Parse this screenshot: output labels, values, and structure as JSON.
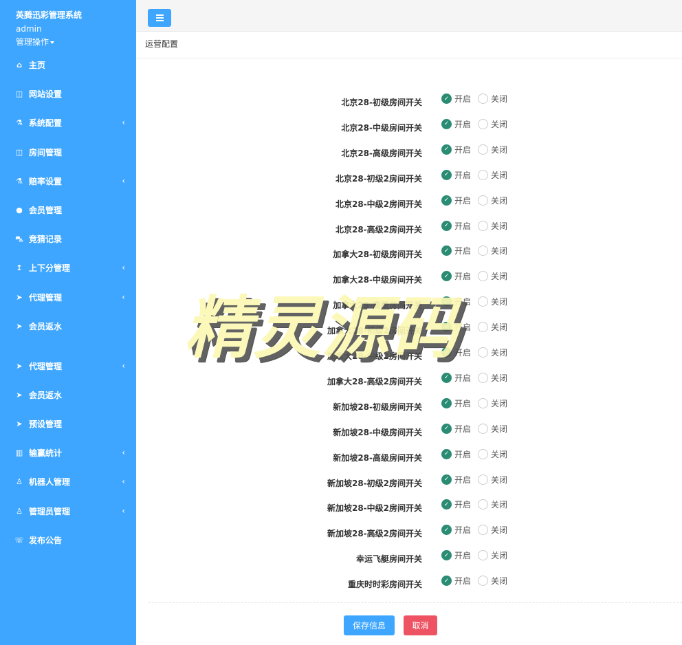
{
  "sidebar": {
    "brand": "英腾迅彩管理系统",
    "user": "admin",
    "ops": "管理操作",
    "items": [
      {
        "label": "主页",
        "icon": "home-icon",
        "glyph": "⌂",
        "chevron": ""
      },
      {
        "label": "网站设置",
        "icon": "columns-icon",
        "glyph": "◫",
        "chevron": ""
      },
      {
        "label": "系统配置",
        "icon": "flask-icon",
        "glyph": "⚗",
        "chevron": "‹"
      },
      {
        "label": "房间管理",
        "icon": "columns-icon",
        "glyph": "◫",
        "chevron": ""
      },
      {
        "label": "赔率设置",
        "icon": "flask-icon",
        "glyph": "⚗",
        "chevron": "‹"
      },
      {
        "label": "会员管理",
        "icon": "user-icon",
        "glyph": "●",
        "chevron": ""
      },
      {
        "label": "竞猜记录",
        "icon": "car-icon",
        "glyph": "⛍",
        "chevron": ""
      },
      {
        "label": "上下分管理",
        "icon": "upload-arrow-icon",
        "glyph": "↥",
        "chevron": "‹"
      },
      {
        "label": "代理管理",
        "icon": "paper-plane-icon",
        "glyph": "➤",
        "chevron": "‹"
      },
      {
        "label": "会员返水",
        "icon": "paper-plane-icon",
        "glyph": "➤",
        "chevron": ""
      },
      {
        "label": "代理管理",
        "icon": "paper-plane-icon",
        "glyph": "➤",
        "chevron": "‹"
      },
      {
        "label": "会员返水",
        "icon": "paper-plane-icon",
        "glyph": "➤",
        "chevron": ""
      },
      {
        "label": "预设管理",
        "icon": "paper-plane-icon",
        "glyph": "➤",
        "chevron": ""
      },
      {
        "label": "输赢统计",
        "icon": "bar-chart-icon",
        "glyph": "▥",
        "chevron": "‹"
      },
      {
        "label": "机器人管理",
        "icon": "person-icon",
        "glyph": "♙",
        "chevron": "‹"
      },
      {
        "label": "管理员管理",
        "icon": "person-icon",
        "glyph": "♙",
        "chevron": "‹"
      },
      {
        "label": "发布公告",
        "icon": "comment-icon",
        "glyph": "☏",
        "chevron": ""
      }
    ]
  },
  "page": {
    "title": "运营配置"
  },
  "form": {
    "on_label": "开启",
    "off_label": "关闭",
    "rows": [
      {
        "label": "北京28-初级房间开关",
        "value": "on"
      },
      {
        "label": "北京28-中级房间开关",
        "value": "on"
      },
      {
        "label": "北京28-高级房间开关",
        "value": "on"
      },
      {
        "label": "北京28-初级2房间开关",
        "value": "on"
      },
      {
        "label": "北京28-中级2房间开关",
        "value": "on"
      },
      {
        "label": "北京28-高级2房间开关",
        "value": "on"
      },
      {
        "label": "加拿大28-初级房间开关",
        "value": "on"
      },
      {
        "label": "加拿大28-中级房间开关",
        "value": "on"
      },
      {
        "label": "加拿大28-高级房间开关",
        "value": "on"
      },
      {
        "label": "加拿大28-初级2房间开关",
        "value": "on"
      },
      {
        "label": "加拿大28-中级2房间开关",
        "value": "on"
      },
      {
        "label": "加拿大28-高级2房间开关",
        "value": "on"
      },
      {
        "label": "新加坡28-初级房间开关",
        "value": "on"
      },
      {
        "label": "新加坡28-中级房间开关",
        "value": "on"
      },
      {
        "label": "新加坡28-高级房间开关",
        "value": "on"
      },
      {
        "label": "新加坡28-初级2房间开关",
        "value": "on"
      },
      {
        "label": "新加坡28-中级2房间开关",
        "value": "on"
      },
      {
        "label": "新加坡28-高级2房间开关",
        "value": "on"
      },
      {
        "label": "幸运飞艇房间开关",
        "value": "on"
      },
      {
        "label": "重庆时时彩房间开关",
        "value": "on"
      }
    ],
    "save_label": "保存信息",
    "cancel_label": "取消"
  },
  "watermark": "精灵源码",
  "colors": {
    "sidebar": "#3ea6ff",
    "checked": "#2a8c73",
    "save": "#3ea6ff",
    "cancel": "#ee5364"
  }
}
